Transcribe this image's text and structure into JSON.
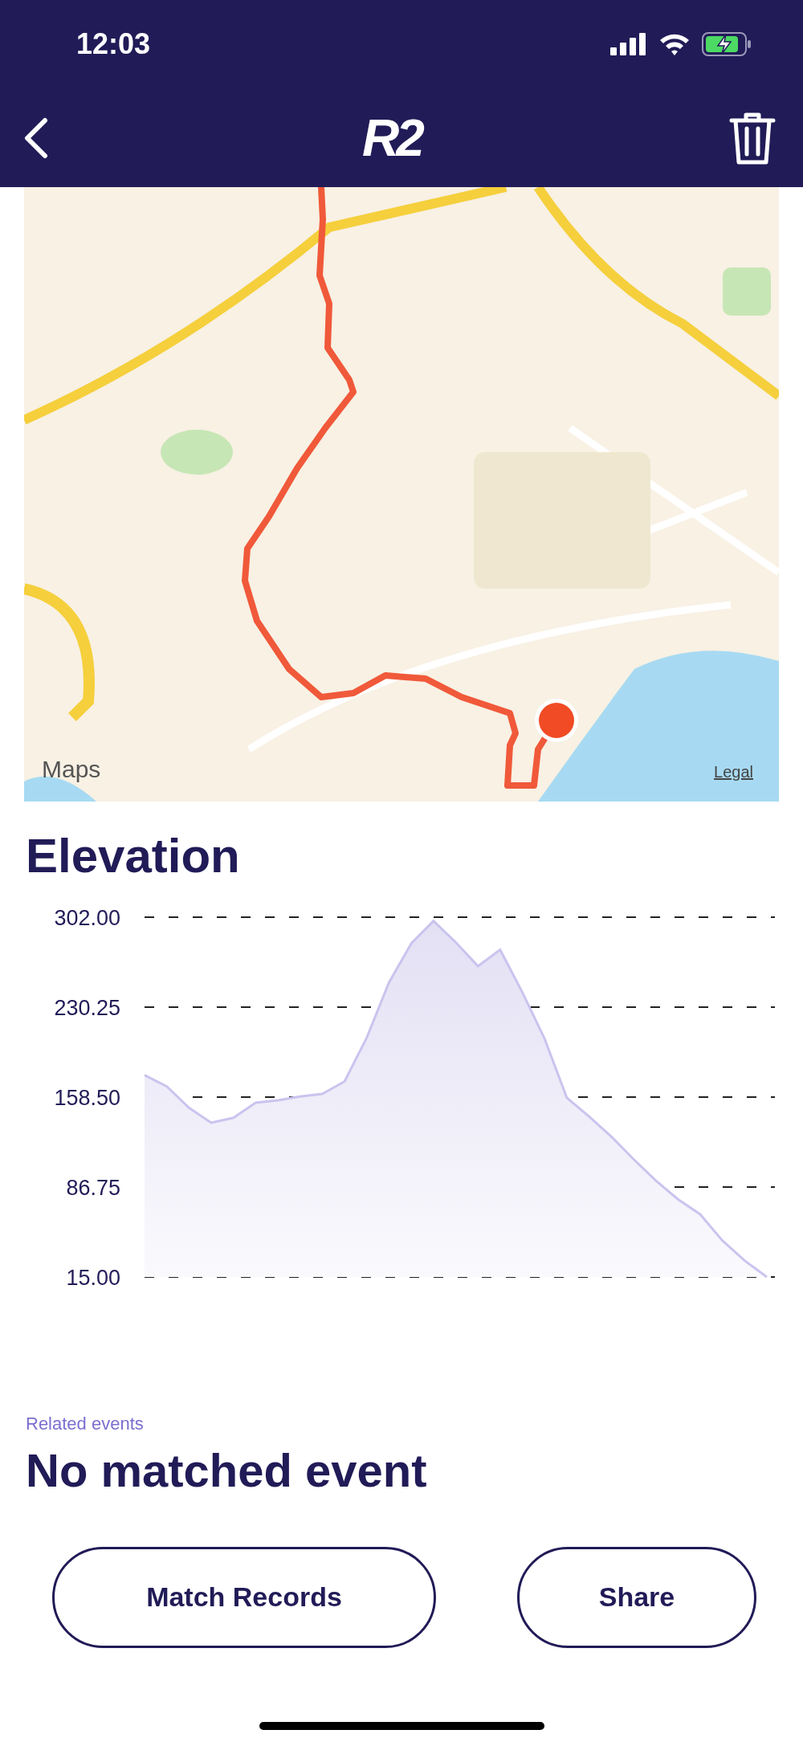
{
  "status_bar": {
    "time": "12:03"
  },
  "header": {
    "logo": "R2"
  },
  "map": {
    "kind": "picture",
    "attribution": "Maps",
    "legal_link": "Legal"
  },
  "elevation": {
    "title": "Elevation",
    "chart_data": {
      "type": "area",
      "categories": [
        null,
        null,
        null,
        null,
        null,
        null,
        null,
        null,
        null,
        null,
        null,
        null,
        null,
        null,
        null,
        null,
        null,
        null,
        null,
        null,
        null,
        null,
        null,
        null,
        null,
        null,
        null,
        null,
        null
      ],
      "series": [
        {
          "color": "#c9c4ee",
          "values": [
            176,
            167,
            150,
            138,
            142,
            154,
            156,
            159,
            161,
            171,
            206,
            250,
            281,
            299,
            282,
            263,
            276,
            242,
            205,
            158,
            143,
            127,
            109,
            92,
            77,
            65,
            44,
            28,
            15
          ]
        }
      ],
      "ylim": [
        15,
        302
      ],
      "grid": true,
      "yticks": [
        {
          "value": 302,
          "label": "302.00"
        },
        {
          "value": 230.25,
          "label": "230.25"
        },
        {
          "value": 158.5,
          "label": "158.50"
        },
        {
          "value": 86.75,
          "label": "86.75"
        },
        {
          "value": 15,
          "label": "15.00"
        }
      ]
    }
  },
  "related": {
    "label": "Related events",
    "value": "No matched event"
  },
  "buttons": [
    {
      "label": "Match Records"
    },
    {
      "label": "Share"
    }
  ]
}
